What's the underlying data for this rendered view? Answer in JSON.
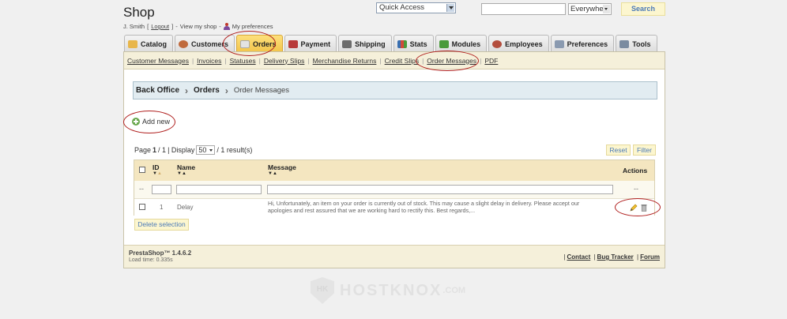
{
  "header": {
    "shop_title": "Shop",
    "user_name": "J. Smith",
    "logout": "Logout",
    "view_my_shop": "View my shop",
    "my_preferences": "My preferences",
    "quick_access": "Quick Access",
    "search_scope": "Everywhere",
    "search_button": "Search"
  },
  "tabs": [
    {
      "label": "Catalog",
      "icon": "catalog-icon",
      "color": "#e8b64a"
    },
    {
      "label": "Customers",
      "icon": "customers-icon",
      "color": "#c06a3c"
    },
    {
      "label": "Orders",
      "icon": "orders-icon",
      "color": "#e3e3e3"
    },
    {
      "label": "Payment",
      "icon": "payment-icon",
      "color": "#b83b3b"
    },
    {
      "label": "Shipping",
      "icon": "shipping-icon",
      "color": "#6d6d6d"
    },
    {
      "label": "Stats",
      "icon": "stats-icon",
      "color": "#3a6fb0"
    },
    {
      "label": "Modules",
      "icon": "modules-icon",
      "color": "#4a9a3a"
    },
    {
      "label": "Employees",
      "icon": "employees-icon",
      "color": "#b34d3d"
    },
    {
      "label": "Preferences",
      "icon": "preferences-icon",
      "color": "#8a9ab0"
    },
    {
      "label": "Tools",
      "icon": "tools-icon",
      "color": "#7a8ba0"
    }
  ],
  "subnav": [
    "Customer Messages",
    "Invoices",
    "Statuses",
    "Delivery Slips",
    "Merchandise Returns",
    "Credit Slips",
    "Order Messages",
    "PDF"
  ],
  "breadcrumb": {
    "root": "Back Office",
    "section": "Orders",
    "current": "Order Messages"
  },
  "add_new": "Add new",
  "pagination": {
    "page_prefix": "Page",
    "page": "1",
    "total_pages": "/ 1",
    "display_prefix": "| Display",
    "per_page": "50",
    "results": "/ 1 result(s)"
  },
  "buttons": {
    "reset": "Reset",
    "filter": "Filter",
    "delete_selection": "Delete selection"
  },
  "table": {
    "headers": {
      "id": "ID",
      "name": "Name",
      "message": "Message",
      "actions": "Actions"
    },
    "filter_placeholder": "--",
    "rows": [
      {
        "id": "1",
        "name": "Delay",
        "message_line1": "Hi, Unfortunately, an item on your order is currently out of stock. This may cause a slight delay in delivery. Please accept our",
        "message_line2": "apologies and rest assured that we are working hard to rectify this. Best regards,..."
      }
    ]
  },
  "footer": {
    "version": "PrestaShop™ 1.4.6.2",
    "load_time": "Load time: 0.335s",
    "contact": "Contact",
    "bug_tracker": "Bug Tracker",
    "forum": "Forum"
  },
  "watermark": {
    "text": "HOSTKNOX",
    "suffix": ".COM"
  },
  "colors": {
    "accent_tab": "#f2c44a",
    "highlight": "#b0201f",
    "button_text": "#4b7ab8",
    "panel_bg": "#f5f0da"
  }
}
